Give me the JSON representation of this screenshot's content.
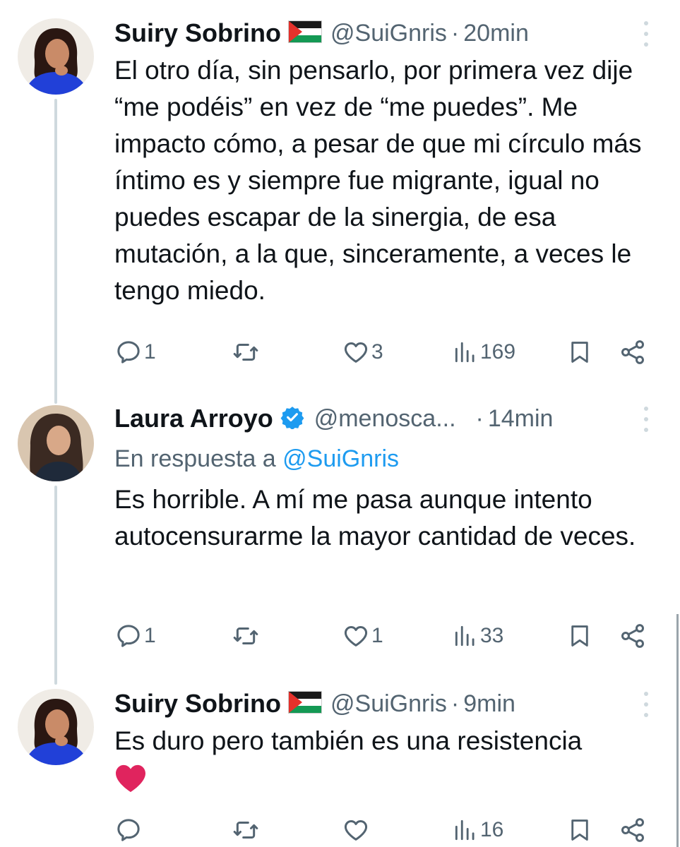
{
  "tweets": [
    {
      "name": "Suiry Sobrino",
      "flag": "palestine-flag",
      "handle": "@SuiGnris",
      "separator": "·",
      "time": "20min",
      "text": "El otro día, sin pensarlo, por primera vez dije “me podéis” en vez de “me puedes”. Me impacto cómo, a pesar de que mi círculo más íntimo es y siempre fue migrante, igual no puedes escapar de la sinergia, de esa mutación, a la que, sinceramente, a veces le tengo miedo.",
      "replies": "1",
      "retweets": "",
      "likes": "3",
      "views": "169"
    },
    {
      "name": "Laura Arroyo",
      "verified": true,
      "handle": "@menosca...",
      "separator": "·",
      "time": "14min",
      "reply_prefix": "En respuesta a",
      "reply_mention": "@SuiGnris",
      "text": "Es horrible. A mí me pasa aunque intento autocensurarme la mayor cantidad de veces.",
      "replies": "1",
      "retweets": "",
      "likes": "1",
      "views": "33"
    },
    {
      "name": "Suiry Sobrino",
      "flag": "palestine-flag",
      "handle": "@SuiGnris",
      "separator": "·",
      "time": "9min",
      "text": "Es duro pero también es una resistencia",
      "emoji": "red-heart",
      "replies": "",
      "retweets": "",
      "likes": "",
      "views": "16"
    }
  ],
  "colors": {
    "text": "#0f1419",
    "secondary": "#536471",
    "link": "#1d9bf0",
    "thread_line": "#cfd9de",
    "heart": "#e0245e",
    "flag_red": "#e4312b",
    "flag_green": "#149954"
  }
}
